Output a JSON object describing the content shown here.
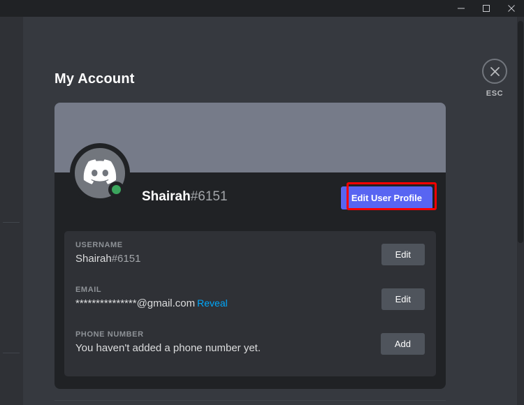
{
  "window": {
    "controls": [
      {
        "name": "minimize",
        "icon": "minimize-icon"
      },
      {
        "name": "maximize",
        "icon": "maximize-icon"
      },
      {
        "name": "close",
        "icon": "close-icon"
      }
    ]
  },
  "header": {
    "title": "My Account",
    "close": {
      "label": "ESC",
      "icon": "close-circle-icon"
    }
  },
  "profile": {
    "avatar_icon": "discord-logo-icon",
    "status": "online",
    "status_color": "#3ba55d",
    "banner_color": "#767b89",
    "username": "Shairah",
    "discriminator": "#6151",
    "edit_profile_label": "Edit User Profile",
    "edit_profile_color": "#5865f2",
    "highlight_color": "#ff0000"
  },
  "fields": [
    {
      "label": "USERNAME",
      "value": "Shairah",
      "tag": "#6151",
      "masked": "",
      "suffix": "",
      "reveal": "",
      "action": "Edit"
    },
    {
      "label": "EMAIL",
      "value": "",
      "tag": "",
      "masked": "***************",
      "suffix": "@gmail.com",
      "reveal": "Reveal",
      "action": "Edit"
    },
    {
      "label": "PHONE NUMBER",
      "value": "You haven't added a phone number yet.",
      "tag": "",
      "masked": "",
      "suffix": "",
      "reveal": "",
      "action": "Add"
    }
  ],
  "colors": {
    "app_bg": "#36393f",
    "card_bg": "#202225",
    "panel_bg": "#2f3136",
    "accent": "#5865f2",
    "link": "#00a8fc",
    "secondary_button": "#4f545c"
  }
}
